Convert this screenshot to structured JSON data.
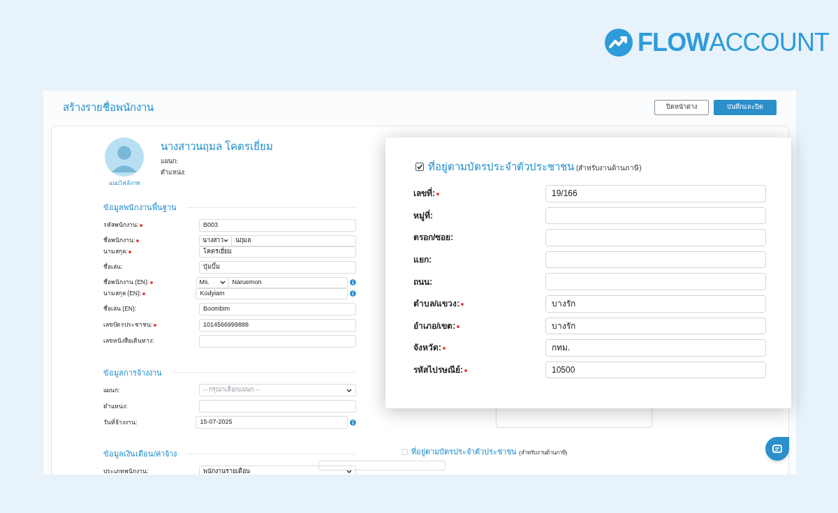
{
  "logo": {
    "bold": "FLOW",
    "light": "ACCOUNT"
  },
  "window": {
    "title": "สร้างรายชื่อพนักงาน",
    "buttons": [
      {
        "label": "ปิดหน้าต่าง",
        "kind": "secondary"
      },
      {
        "label": "บันทึกและปิด",
        "kind": "primary"
      }
    ]
  },
  "profile": {
    "name": "นางสาวนฤมล โคตรเยี่ยม",
    "photo_link": "แนบไฟล์ภาพ",
    "details": [
      "แผนก:",
      "ตำแหน่ง:"
    ]
  },
  "sections": [
    {
      "title": "ข้อมูลพนักงานพื้นฐาน",
      "groups": [
        [
          {
            "label": "รหัสพนักงาน:",
            "required": true,
            "kind": "text",
            "value": "B003",
            "info": false
          }
        ],
        [
          {
            "label": "ชื่อพนักงาน:",
            "required": true,
            "kind": "name",
            "prefix": "นางสาว",
            "value": "นฤมล",
            "info": false
          },
          {
            "label": "นามสกุล:",
            "required": true,
            "kind": "text",
            "value": "โคตรเยี่ยม",
            "info": false
          }
        ],
        [
          {
            "label": "ชื่อเล่น:",
            "required": false,
            "kind": "text",
            "value": "บุ้มบิ้ม",
            "info": false
          }
        ],
        [
          {
            "label": "ชื่อพนักงาน (EN):",
            "required": true,
            "kind": "name",
            "prefix": "Ms.",
            "value": "Naruemon",
            "info": true
          },
          {
            "label": "นามสกุล (EN):",
            "required": true,
            "kind": "text",
            "value": "Kodyiam",
            "info": true
          }
        ],
        [
          {
            "label": "ชื่อเล่น (EN):",
            "required": false,
            "kind": "text",
            "value": "Boombim",
            "info": false
          }
        ],
        [
          {
            "label": "เลขบัตรประชาชน:",
            "required": true,
            "kind": "text",
            "value": "1014566999888",
            "info": false
          }
        ],
        [
          {
            "label": "เลขหนังสือเดินทาง:",
            "required": false,
            "kind": "text",
            "info": false
          }
        ]
      ]
    },
    {
      "title": "ข้อมูลการจ้างงาน",
      "groups": [
        [
          {
            "label": "แผนก:",
            "required": false,
            "kind": "select",
            "placeholder": "-- กรุณาเลือกแผนก --",
            "info": false
          }
        ],
        [
          {
            "label": "ตำแหน่ง:",
            "required": false,
            "kind": "text",
            "info": false
          }
        ],
        [
          {
            "label": "วันที่จ้างงาน:",
            "required": false,
            "kind": "text",
            "value": "15-07-2025",
            "info": true
          }
        ]
      ]
    },
    {
      "title": "ข้อมูลเงินเดือน/ค่าจ้าง",
      "groups": [
        [
          {
            "label": "ประเภทพนักงาน:",
            "required": false,
            "kind": "select",
            "value": "พนักงานรายเดือน",
            "info": false
          }
        ]
      ]
    }
  ],
  "address_option": {
    "checked": false,
    "label": "ที่อยู่ตามบัตรประจำตัวประชาชน",
    "note": "(สำหรับงานด้านภาษี)"
  },
  "popup": {
    "checked": true,
    "label": "ที่อยู่ตามบัตรประจำตัวประชาชน",
    "note": "(สำหรับงานด้านภาษี)",
    "fields": [
      {
        "label": "เลขที่:",
        "required": true,
        "value": "19/166"
      },
      {
        "label": "หมู่ที่:",
        "required": false
      },
      {
        "label": "ตรอก/ซอย:",
        "required": false
      },
      {
        "label": "แยก:",
        "required": false
      },
      {
        "label": "ถนน:",
        "required": false
      },
      {
        "label": "ตำบล/แขวง:",
        "required": true,
        "value": "บางรัก"
      },
      {
        "label": "อำเภอ/เขต:",
        "required": true,
        "value": "บางรัก"
      },
      {
        "label": "จังหวัด:",
        "required": true,
        "value": "กทม."
      },
      {
        "label": "รหัสไปรษณีย์:",
        "required": true,
        "value": "10500"
      }
    ]
  }
}
